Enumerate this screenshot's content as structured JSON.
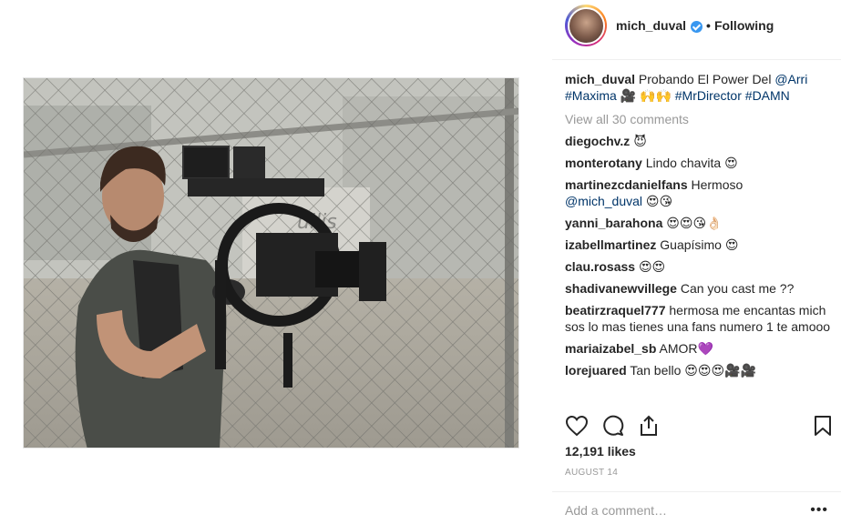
{
  "post": {
    "username": "mich_duval",
    "follow_label": "Following",
    "dot": "•"
  },
  "caption": {
    "username": "mich_duval",
    "text_1": "Probando El Power Del ",
    "mention": "@Arri",
    "tag1": "#Maxima",
    "emojis": " 🎥 🙌🙌 ",
    "tag2": "#MrDirector",
    "tag3": "#DAMN"
  },
  "view_all": "View all 30 comments",
  "comments": [
    {
      "user": "diegochv.z",
      "text": "😈"
    },
    {
      "user": "monterotany",
      "text": "Lindo chavita 😍"
    },
    {
      "user": "martinezcdanielfans",
      "text": "Hermoso",
      "mention": "@mich_duval",
      "after": " 😍😘"
    },
    {
      "user": "yanni_barahona",
      "text": "😍😍😘👌🏻"
    },
    {
      "user": "izabellmartinez",
      "text": "Guapísimo 😍"
    },
    {
      "user": "clau.rosass",
      "text": "😍😍"
    },
    {
      "user": "shadivanewvillege",
      "text": "Can you cast me ??"
    },
    {
      "user": "beatirzraquel777",
      "text": "hermosa me encantas mich sos lo mas tienes una fans numero 1 te amooo"
    },
    {
      "user": "mariaizabel_sb",
      "text": "AMOR💜"
    },
    {
      "user": "lorejuared",
      "text": "Tan bello 😍😍😍🎥🎥"
    }
  ],
  "likes": "12,191 likes",
  "date": "AUGUST 14",
  "add_comment_placeholder": "Add a comment…",
  "more_label": "•••",
  "icons": {
    "like": "heart-icon",
    "comment": "comment-icon",
    "share": "share-icon",
    "save": "bookmark-icon",
    "verified": "verified-badge-icon"
  },
  "colors": {
    "link": "#003569",
    "muted": "#999999",
    "verified": "#3897f0"
  }
}
